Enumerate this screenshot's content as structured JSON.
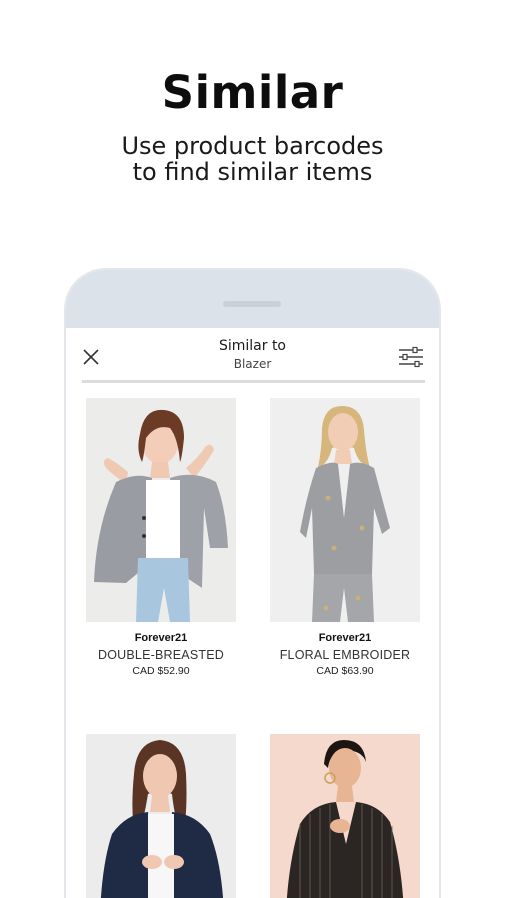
{
  "promo": {
    "title": "Similar",
    "subtitle_line1": "Use product barcodes",
    "subtitle_line2": "to find similar items"
  },
  "header": {
    "title": "Similar to",
    "subtitle": "Blazer",
    "close_icon": "close-icon",
    "filter_icon": "sliders-icon"
  },
  "products": [
    {
      "brand": "Forever21",
      "name": "DOUBLE-BREASTED",
      "price": "CAD $52.90"
    },
    {
      "brand": "Forever21",
      "name": "FLORAL EMBROIDER",
      "price": "CAD $63.90"
    }
  ],
  "colors": {
    "phone_frame": "#dbe2ea",
    "text_dark": "#111111"
  }
}
